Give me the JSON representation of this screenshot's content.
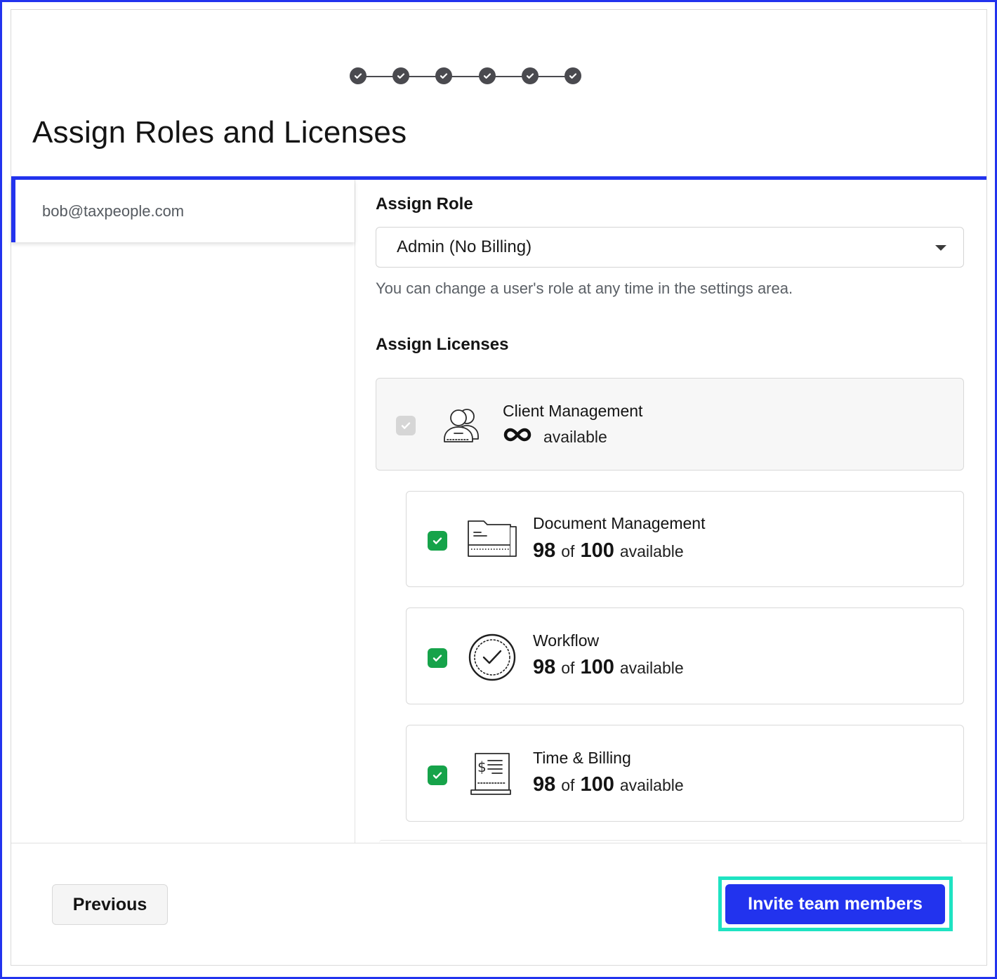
{
  "stepper": {
    "completed_steps": 6,
    "total_steps": 6
  },
  "page": {
    "title": "Assign Roles and Licenses"
  },
  "users": [
    {
      "email": "bob@taxpeople.com"
    }
  ],
  "role": {
    "label": "Assign Role",
    "selected": "Admin (No Billing)",
    "hint": "You can change a user's role at any time in the settings area."
  },
  "licenses": {
    "label": "Assign Licenses",
    "items": [
      {
        "name": "Client Management",
        "availability": "available",
        "unlimited": true,
        "checked": true,
        "disabled": true,
        "icon": "users-icon"
      },
      {
        "name": "Document Management",
        "used": "98",
        "of": "of",
        "total": "100",
        "availability": "available",
        "checked": true,
        "icon": "folder-icon"
      },
      {
        "name": "Workflow",
        "used": "98",
        "of": "of",
        "total": "100",
        "availability": "available",
        "checked": true,
        "icon": "check-circle-icon"
      },
      {
        "name": "Time & Billing",
        "used": "98",
        "of": "of",
        "total": "100",
        "availability": "available",
        "checked": true,
        "icon": "invoice-icon"
      }
    ]
  },
  "footer": {
    "previous_label": "Previous",
    "invite_label": "Invite team members"
  },
  "colors": {
    "accent": "#2233ee",
    "check_green": "#16a34a",
    "focus_ring": "#1ee3c2",
    "stepper_gray": "#4a4a4f"
  }
}
